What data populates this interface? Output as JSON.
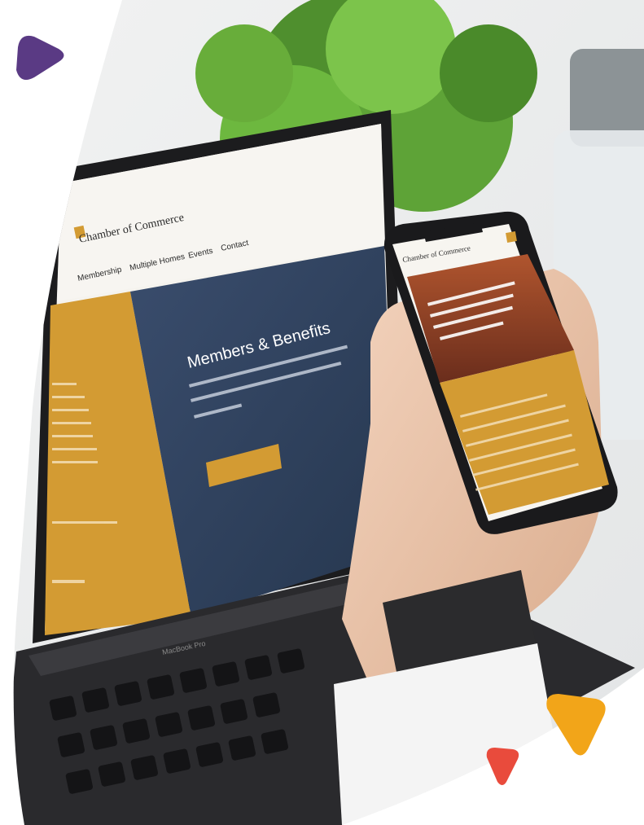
{
  "laptop_site": {
    "brand": "Chamber of Commerce",
    "nav": [
      "Membership",
      "Multiple Homes",
      "Events",
      "Contact"
    ],
    "hero_title": "Members & Benefits",
    "hero_button": "",
    "laptop_model": "MacBook Pro"
  },
  "phone_site": {
    "brand": "Chamber of Commerce"
  },
  "colors": {
    "accent_gold": "#d39b33",
    "navy": "#2c3f5f",
    "purple": "#5a3a84",
    "orange": "#f2a519",
    "red": "#e94b3c"
  },
  "decor": {
    "shapes": [
      "purple-triangle-icon",
      "orange-triangle-icon",
      "red-triangle-icon"
    ]
  }
}
